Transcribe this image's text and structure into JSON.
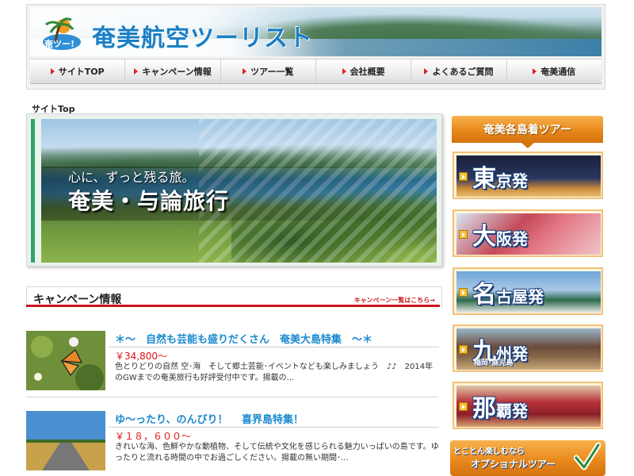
{
  "header": {
    "logo_badge": "奄ツー!",
    "site_title": "奄美航空ツーリスト",
    "nav": [
      {
        "label": "サイトTOP",
        "icon": "triangle-right-icon"
      },
      {
        "label": "キャンペーン情報",
        "icon": "triangle-right-icon"
      },
      {
        "label": "ツアー一覧",
        "icon": "triangle-right-icon"
      },
      {
        "label": "会社概要",
        "icon": "triangle-right-icon"
      },
      {
        "label": "よくあるご質問",
        "icon": "triangle-right-icon"
      },
      {
        "label": "奄美通信",
        "icon": "triangle-right-icon"
      }
    ]
  },
  "breadcrumb": "サイトTop",
  "hero": {
    "subtitle": "心に、ずっと残る旅。",
    "title": "奄美・与論旅行"
  },
  "campaign": {
    "heading": "キャンペーン情報",
    "more_link": "キャンペーン一覧はこちら→",
    "items": [
      {
        "title": "＊～　自然も芸能も盛りだくさん　奄美大島特集　～＊",
        "price": "￥34,800～",
        "text": "色とりどりの自然 空･海　そして郷土芸能･イベントなども楽しみましょう　♪♪　2014年のGWまでの奄美旅行も好評受付中です。揚載の..."
      },
      {
        "title": "ゆ～ったり、のんびり！　 喜界島特集！",
        "price": "￥１８，６００～",
        "text": "きれいな海、色鮮やかな動植物、そして伝統や文化を感じられる魅力いっぱいの島です。ゆったりと流れる時間の中でお過ごしください。揚載の無い期間･..."
      }
    ]
  },
  "sidebar": {
    "heading": "奄美各島着ツアー",
    "tours": [
      {
        "big": "東",
        "rest": "京発",
        "sub": ""
      },
      {
        "big": "大",
        "rest": "阪発",
        "sub": ""
      },
      {
        "big": "名",
        "rest": "古屋発",
        "sub": ""
      },
      {
        "big": "九",
        "rest": "州発",
        "sub": "福岡･鹿児島"
      },
      {
        "big": "那",
        "rest": "覇発",
        "sub": ""
      }
    ],
    "optional_line1": "とことん楽しむなら",
    "optional_line2": "オプショナルツアー"
  },
  "colors": {
    "brand_blue": "#1a7fc6",
    "campaign_red": "#c9161e",
    "sidebar_orange": "#e7871a",
    "price_red": "#dd1111"
  }
}
